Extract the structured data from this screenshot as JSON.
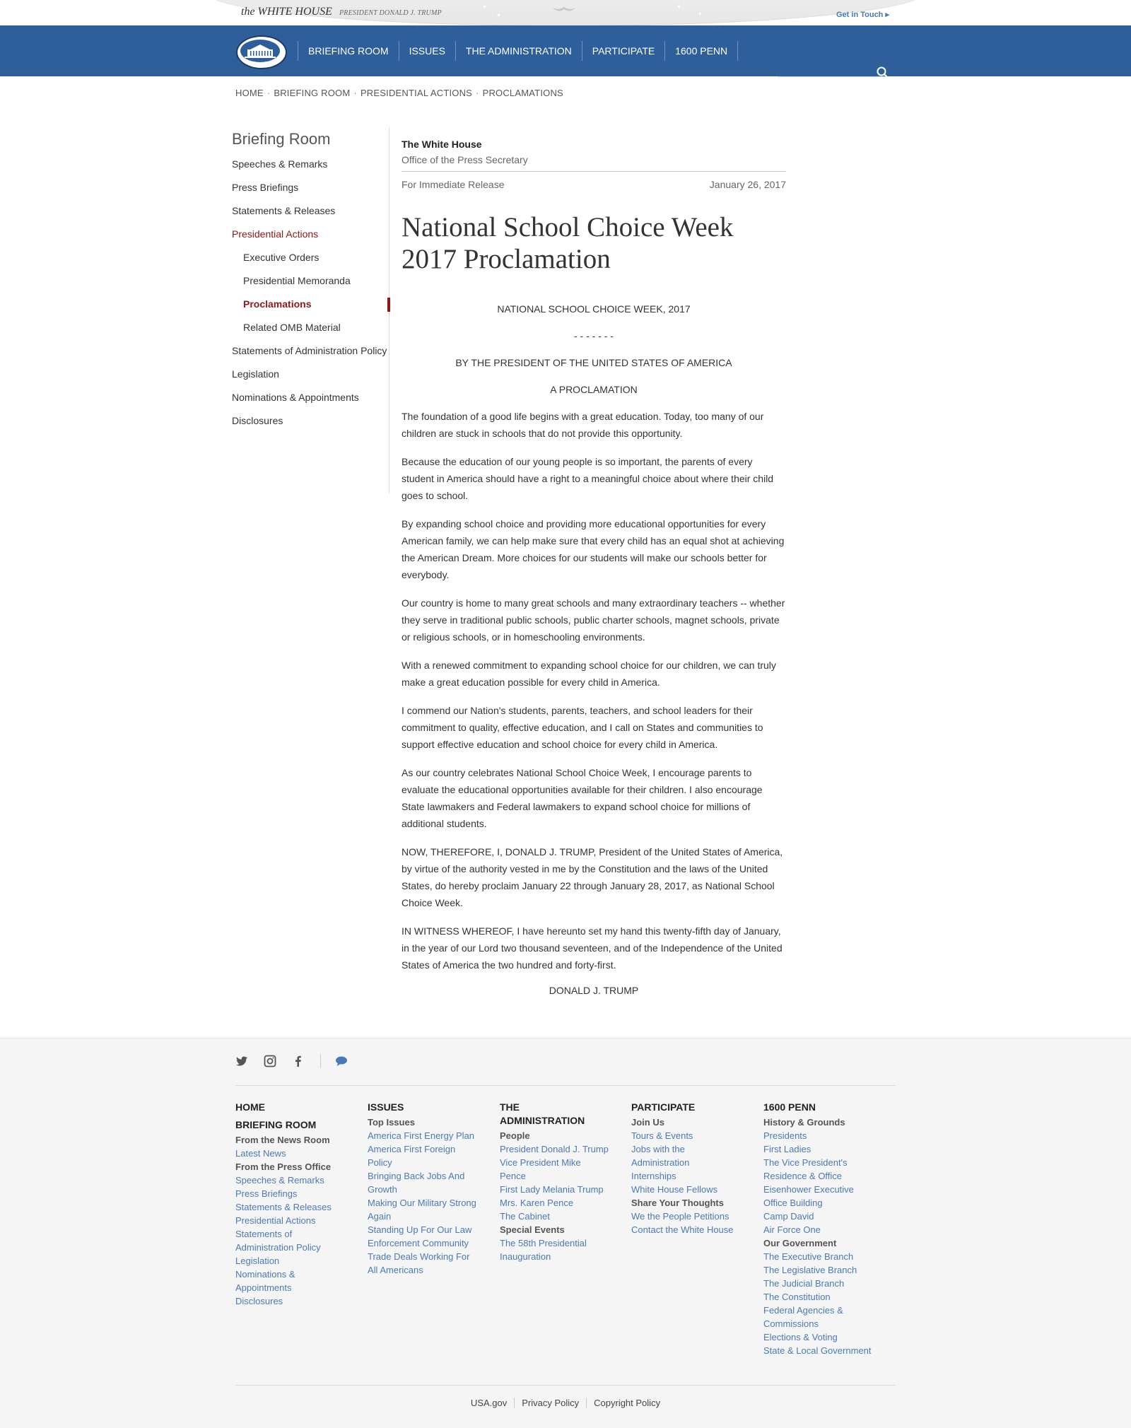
{
  "brand": {
    "title": "the WHITE HOUSE",
    "subtitle": "PRESIDENT DONALD J. TRUMP",
    "get_in_touch": "Get in Touch ▸"
  },
  "nav": {
    "items": [
      "BRIEFING ROOM",
      "ISSUES",
      "THE ADMINISTRATION",
      "PARTICIPATE",
      "1600 PENN"
    ],
    "search_placeholder": ""
  },
  "breadcrumb": [
    "HOME",
    "BRIEFING ROOM",
    "PRESIDENTIAL ACTIONS",
    "PROCLAMATIONS"
  ],
  "sidebar": {
    "title": "Briefing Room",
    "items": [
      {
        "label": "Speeches & Remarks"
      },
      {
        "label": "Press Briefings"
      },
      {
        "label": "Statements & Releases"
      },
      {
        "label": "Presidential Actions"
      },
      {
        "label": "Executive Orders"
      },
      {
        "label": "Presidential Memoranda"
      },
      {
        "label": "Proclamations"
      },
      {
        "label": "Related OMB Material"
      },
      {
        "label": "Statements of Administration Policy"
      },
      {
        "label": "Legislation"
      },
      {
        "label": "Nominations & Appointments"
      },
      {
        "label": "Disclosures"
      }
    ]
  },
  "article": {
    "issuer": "The White House",
    "office": "Office of the Press Secretary",
    "release": "For Immediate Release",
    "date": "January 26, 2017",
    "title": "National School Choice Week 2017 Proclamation",
    "heading": "NATIONAL SCHOOL CHOICE WEEK, 2017",
    "dashes": "- - - - - - -",
    "by_line": "BY THE PRESIDENT OF THE UNITED STATES OF AMERICA",
    "proclamation": "A PROCLAMATION",
    "paragraphs": [
      "The foundation of a good life begins with a great education.  Today, too many of our children are stuck in schools that do not provide this opportunity.",
      "Because the education of our young people is so important, the parents of every student in America should have a right to a meaningful choice about where their child goes to school.",
      "By expanding school choice and providing more educational opportunities for every American family, we can help make sure that every child has an equal shot at achieving the American Dream.  More choices for our students will make our schools better for everybody.",
      "Our country is home to many great schools and many extraordinary teachers -- whether they serve in traditional public schools, public charter schools, magnet schools, private or religious schools, or in homeschooling environments.",
      "With a renewed commitment to expanding school choice for our children, we can truly make a great education possible for every child in America.",
      "I commend our Nation's students, parents, teachers, and school leaders for their commitment to quality, effective education, and I call on States and communities to support effective education and school choice for every child in America.",
      "As our country celebrates National School Choice Week, I encourage parents to evaluate the educational opportunities available for their children.  I also encourage State lawmakers and Federal lawmakers to expand school choice for millions of additional students.",
      "NOW, THEREFORE, I, DONALD J. TRUMP, President of the United States of America, by virtue of the authority vested in me by the Constitution and the laws of the United States, do hereby proclaim January 22 through January 28, 2017, as National School Choice Week.",
      "IN WITNESS WHEREOF, I have hereunto set my hand this twenty-fifth day of January, in the year of our Lord two thousand seventeen, and of the Independence of the United States of America the two hundred and forty-first."
    ],
    "signature": "DONALD J. TRUMP"
  },
  "footer": {
    "col1": {
      "home": "HOME",
      "briefing": "BRIEFING ROOM",
      "sub1": "From the News Room",
      "link1": "Latest News",
      "sub2": "From the Press Office",
      "links": [
        "Speeches & Remarks",
        "Press Briefings",
        "Statements & Releases",
        "Presidential Actions",
        "Statements of Administration Policy",
        "Legislation",
        "Nominations & Appointments",
        "Disclosures"
      ]
    },
    "col2": {
      "head": "ISSUES",
      "sub": "Top Issues",
      "links": [
        "America First Energy Plan",
        "America First Foreign Policy",
        "Bringing Back Jobs And Growth",
        "Making Our Military Strong Again",
        "Standing Up For Our Law Enforcement Community",
        "Trade Deals Working For All Americans"
      ]
    },
    "col3": {
      "head": "THE ADMINISTRATION",
      "sub1": "People",
      "links1": [
        "President Donald J. Trump",
        "Vice President Mike Pence",
        "First Lady Melania Trump",
        "Mrs. Karen Pence",
        "The Cabinet"
      ],
      "sub2": "Special Events",
      "links2": [
        "The 58th Presidential Inauguration"
      ]
    },
    "col4": {
      "head": "PARTICIPATE",
      "sub1": "Join Us",
      "links1": [
        "Tours & Events",
        "Jobs with the Administration",
        "Internships",
        "White House Fellows"
      ],
      "sub2": "Share Your Thoughts",
      "links2": [
        "We the People Petitions",
        "Contact the White House"
      ]
    },
    "col5": {
      "head": "1600 PENN",
      "sub1": "History & Grounds",
      "links1": [
        "Presidents",
        "First Ladies",
        "The Vice President's Residence & Office",
        "Eisenhower Executive Office Building",
        "Camp David",
        "Air Force One"
      ],
      "sub2": "Our Government",
      "links2": [
        "The Executive Branch",
        "The Legislative Branch",
        "The Judicial Branch",
        "The Constitution",
        "Federal Agencies & Commissions",
        "Elections & Voting",
        "State & Local Government"
      ]
    },
    "bottom_links": [
      "USA.gov",
      "Privacy Policy",
      "Copyright Policy"
    ]
  },
  "colors": {
    "nav_blue": "#2e5f9a",
    "active_red": "#8b1a1a",
    "link_blue": "#4a7ab5"
  }
}
